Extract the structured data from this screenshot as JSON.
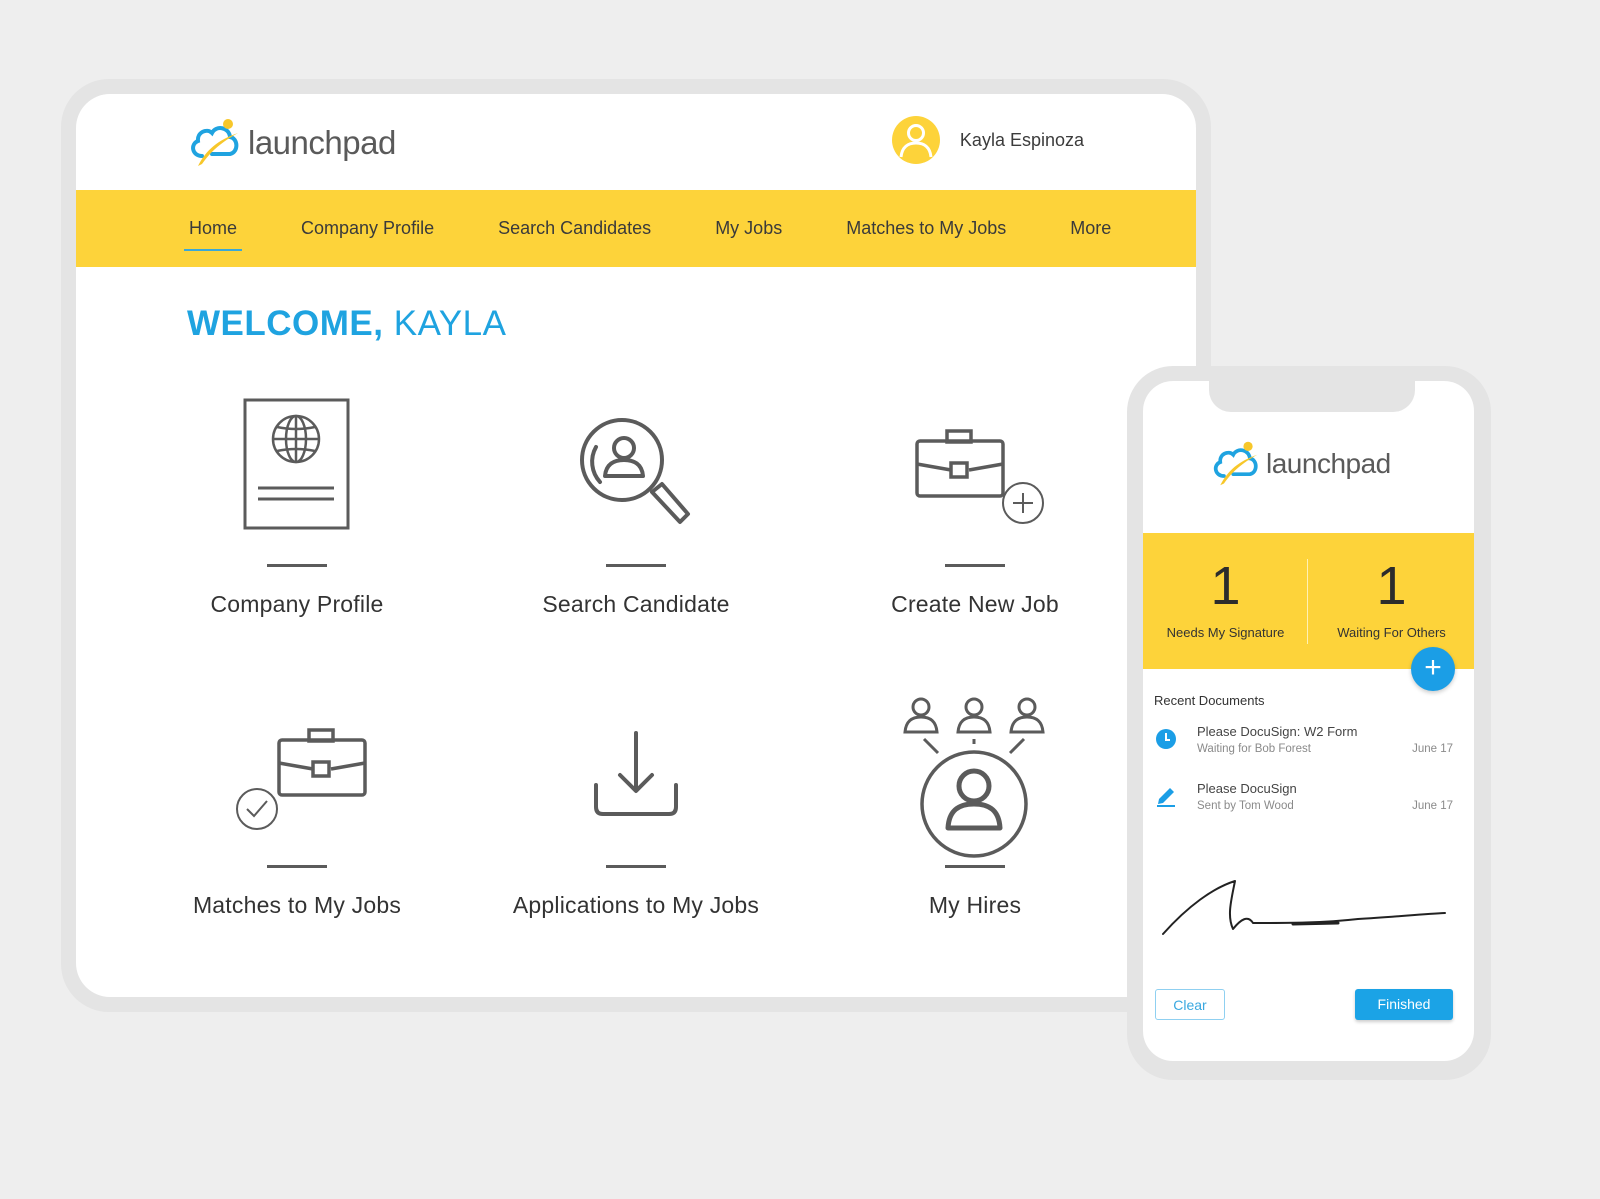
{
  "brand": {
    "name": "launchpad",
    "colors": {
      "primary_yellow": "#fdd33a",
      "accent_blue": "#1fa3e0",
      "icon_gray": "#5b5b5b",
      "background": "#eeeeee"
    }
  },
  "tablet": {
    "header": {
      "logo_text": "launchpad",
      "user": {
        "name": "Kayla Espinoza",
        "avatar_icon": "user-avatar-icon"
      }
    },
    "nav": {
      "items": [
        {
          "label": "Home",
          "active": true
        },
        {
          "label": "Company Profile",
          "active": false
        },
        {
          "label": "Search Candidates",
          "active": false
        },
        {
          "label": "My Jobs",
          "active": false
        },
        {
          "label": "Matches to My Jobs",
          "active": false
        },
        {
          "label": "More",
          "active": false
        }
      ]
    },
    "welcome": {
      "greeting": "WELCOME,",
      "name": "KAYLA"
    },
    "tiles": [
      {
        "label": "Company Profile",
        "icon": "passport-globe-icon"
      },
      {
        "label": "Search Candidate",
        "icon": "search-person-icon"
      },
      {
        "label": "Create New Job",
        "icon": "briefcase-plus-icon"
      },
      {
        "label": "Matches to My Jobs",
        "icon": "briefcase-check-icon"
      },
      {
        "label": "Applications to My Jobs",
        "icon": "download-icon"
      },
      {
        "label": "My Hires",
        "icon": "people-network-icon"
      }
    ]
  },
  "phone": {
    "logo_text": "launchpad",
    "stats": [
      {
        "value": "1",
        "label": "Needs My Signature"
      },
      {
        "value": "1",
        "label": "Waiting For Others"
      }
    ],
    "fab_label": "+",
    "recent_documents": {
      "title": "Recent Documents",
      "items": [
        {
          "title": "Please DocuSign: W2 Form",
          "subtitle": "Waiting for Bob Forest",
          "date": "June 17",
          "icon": "clock-icon"
        },
        {
          "title": "Please DocuSign",
          "subtitle": "Sent by Tom Wood",
          "date": "June 17",
          "icon": "pencil-icon"
        }
      ]
    },
    "buttons": {
      "clear": "Clear",
      "finished": "Finished"
    }
  }
}
